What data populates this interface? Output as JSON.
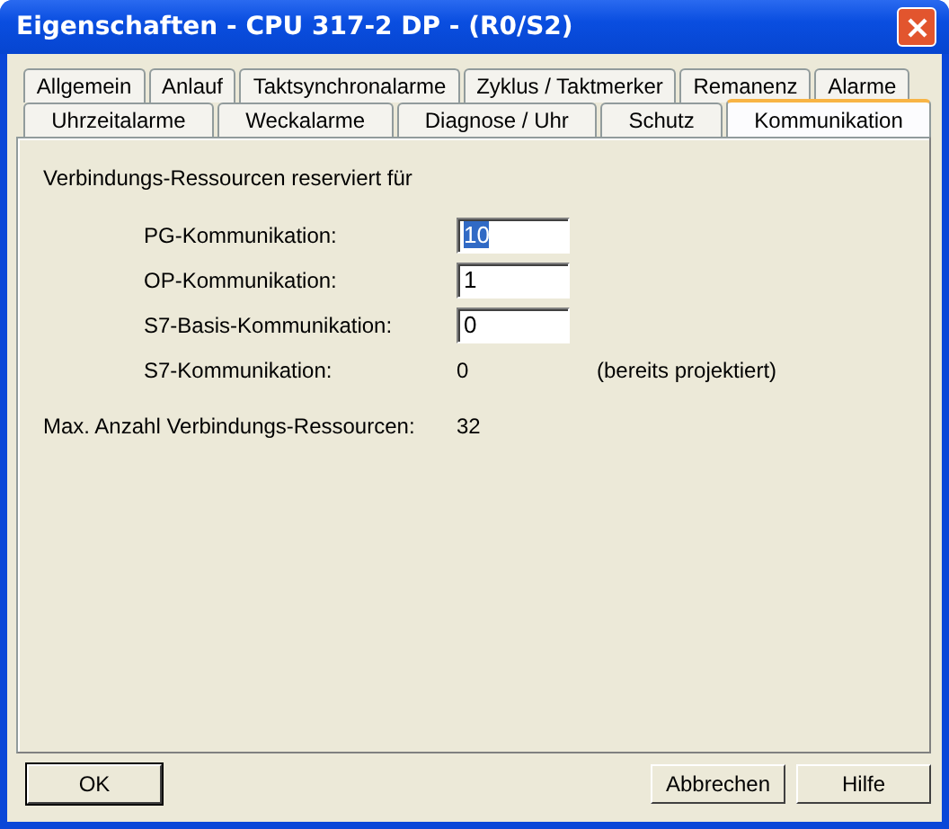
{
  "window": {
    "title": "Eigenschaften - CPU 317-2 DP - (R0/S2)"
  },
  "tab_rows": [
    [
      {
        "label": "Allgemein",
        "selected": false
      },
      {
        "label": "Anlauf",
        "selected": false
      },
      {
        "label": "Taktsynchronalarme",
        "selected": false
      },
      {
        "label": "Zyklus / Taktmerker",
        "selected": false
      },
      {
        "label": "Remanenz",
        "selected": false
      },
      {
        "label": "Alarme",
        "selected": false
      }
    ],
    [
      {
        "label": "Uhrzeitalarme",
        "selected": false
      },
      {
        "label": "Weckalarme",
        "selected": false
      },
      {
        "label": "Diagnose / Uhr",
        "selected": false
      },
      {
        "label": "Schutz",
        "selected": false
      },
      {
        "label": "Kommunikation",
        "selected": true
      }
    ]
  ],
  "group_label": "Verbindungs-Ressourcen reserviert für",
  "rows": [
    {
      "kind": "input",
      "label": "PG-Kommunikation:",
      "value": "10",
      "focused": true
    },
    {
      "kind": "input",
      "label": "OP-Kommunikation:",
      "value": "1",
      "focused": false
    },
    {
      "kind": "input",
      "label": "S7-Basis-Kommunikation:",
      "value": "0",
      "focused": false
    },
    {
      "kind": "value",
      "label": "S7-Kommunikation:",
      "value": "0",
      "note": "(bereits projektiert)"
    }
  ],
  "max": {
    "label": "Max. Anzahl Verbindungs-Ressourcen:",
    "value": "32"
  },
  "buttons": [
    {
      "label": "OK",
      "default": true
    },
    {
      "label": "Abbrechen",
      "default": false
    },
    {
      "label": "Hilfe",
      "default": false
    }
  ]
}
